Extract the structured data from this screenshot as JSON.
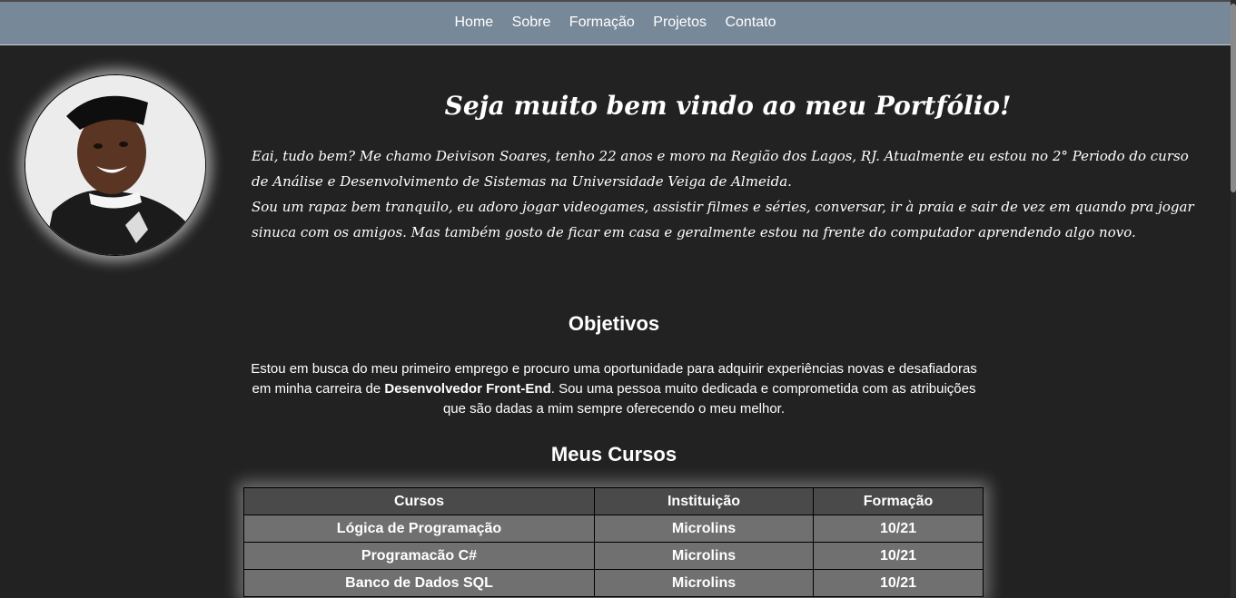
{
  "nav": {
    "items": [
      "Home",
      "Sobre",
      "Formação",
      "Projetos",
      "Contato"
    ]
  },
  "hero": {
    "title": "Seja muito bem vindo ao meu Portfólio!",
    "intro_p1_a": "Eai, tudo bem? Me chamo Deivison Soares, tenho 22 anos e moro na Região dos Lagos, RJ. Atualmente eu estou no 2° Periodo do curso de Análise e Desenvolvimento de Sistemas na ",
    "intro_p1_b": "Universidade Veiga de Almeida.",
    "intro_p2": "Sou um rapaz bem tranquilo, eu adoro jogar videogames, assistir filmes e séries, conversar, ir à praia e sair de vez em quando pra jogar sinuca com os amigos. Mas também gosto de ficar em casa e geralmente estou na frente do computador aprendendo algo novo."
  },
  "objetivos": {
    "title": "Objetivos",
    "text_a": "Estou em busca do meu primeiro emprego e procuro uma oportunidade para adquirir experiências novas e desafiadoras em minha carreira de ",
    "text_bold": "Desenvolvedor Front-End",
    "text_b": ". Sou uma pessoa muito dedicada e comprometida com as atribuições que são dadas a mim sempre oferecendo o meu melhor."
  },
  "cursos": {
    "title": "Meus Cursos",
    "headers": [
      "Cursos",
      "Instituição",
      "Formação"
    ],
    "rows": [
      [
        "Lógica de Programação",
        "Microlins",
        "10/21"
      ],
      [
        "Programacão C#",
        "Microlins",
        "10/21"
      ],
      [
        "Banco de Dados SQL",
        "Microlins",
        "10/21"
      ]
    ]
  }
}
